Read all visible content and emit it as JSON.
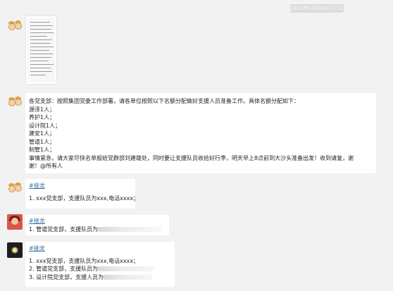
{
  "timestamp": "2022年10月26日 9:31",
  "messages": [
    {
      "id": "announcement",
      "lines": [
        "各党支部：按照集团党委工作部署，请各单位按照以下名额分配做好支援人员准备工作。具体名额分配如下：",
        "源泽1人；",
        "养护1人；",
        "设计院1人；",
        "建安1人；",
        "管道1人；",
        "制管1人；",
        "事情紧急，请大家尽快名单报给党群部刘建雄处，同时要让支援队员收拾好行李，明天早上8点前到大沙头准备出发！收到请复，谢",
        "谢！@所有人"
      ]
    },
    {
      "id": "jielong-1",
      "tag": "#接龙",
      "lines": [
        "1. xxx党支部，支援队员为xxx,电话xxxx；"
      ]
    },
    {
      "id": "jielong-2",
      "tag": "#接龙",
      "lines": [
        "1. 管道党支部，支援队员为"
      ]
    },
    {
      "id": "jielong-3",
      "tag": "#接龙",
      "lines": [
        "1. xxx党支部，支援队员为xxx,电话xxxx；",
        "2. 管道党支部，支援队员为",
        "3. 设计院党支部，支援人员为"
      ]
    }
  ],
  "icons": {
    "avatar_1": "cartoon-couple-avatar",
    "avatar_2": "cartoon-couple-avatar",
    "avatar_3": "cartoon-couple-avatar",
    "avatar_4": "red-portrait-avatar",
    "avatar_5": "dark-sunset-avatar"
  },
  "colors": {
    "background": "#f2f2f2",
    "bubble": "#ffffff",
    "tag": "#3a6ea5"
  }
}
